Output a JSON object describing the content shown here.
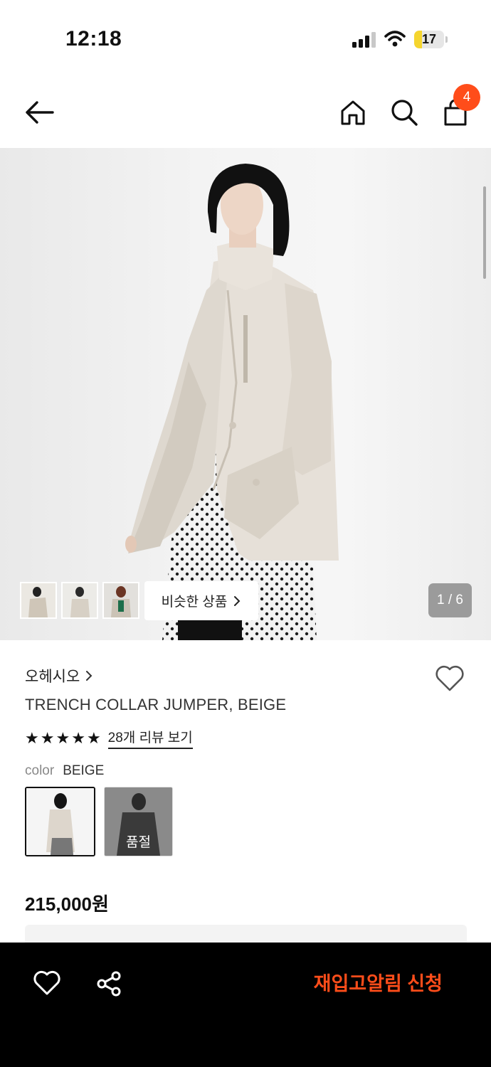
{
  "status_bar": {
    "time": "12:18",
    "battery": "17",
    "battery_level": 0.17,
    "battery_color": "#f5d52e"
  },
  "header": {
    "back_icon": "arrow-left-icon",
    "home_icon": "home-icon",
    "search_icon": "search-icon",
    "cart_icon": "shopping-bag-icon",
    "cart_count": "4",
    "badge_color": "#ff4d1a"
  },
  "gallery": {
    "similar_label": "비슷한 상품",
    "similar_icon": "chevron-right-icon",
    "counter": "1 / 6"
  },
  "product": {
    "brand": "오헤시오",
    "brand_chevron": "chevron-right-icon",
    "name": "TRENCH COLLAR JUMPER, BEIGE",
    "rating_stars": 5,
    "review_link": "28개 리뷰 보기",
    "color_label": "color",
    "color_value": "BEIGE",
    "swatches": [
      {
        "name": "beige",
        "selected": true,
        "status": ""
      },
      {
        "name": "black",
        "selected": false,
        "status": "품절"
      }
    ],
    "price": "215,000원"
  },
  "bottom_bar": {
    "wishlist_icon": "heart-outline-icon",
    "share_icon": "share-icon",
    "restock_label": "재입고알림 신청",
    "accent_color": "#ff4d1a"
  }
}
